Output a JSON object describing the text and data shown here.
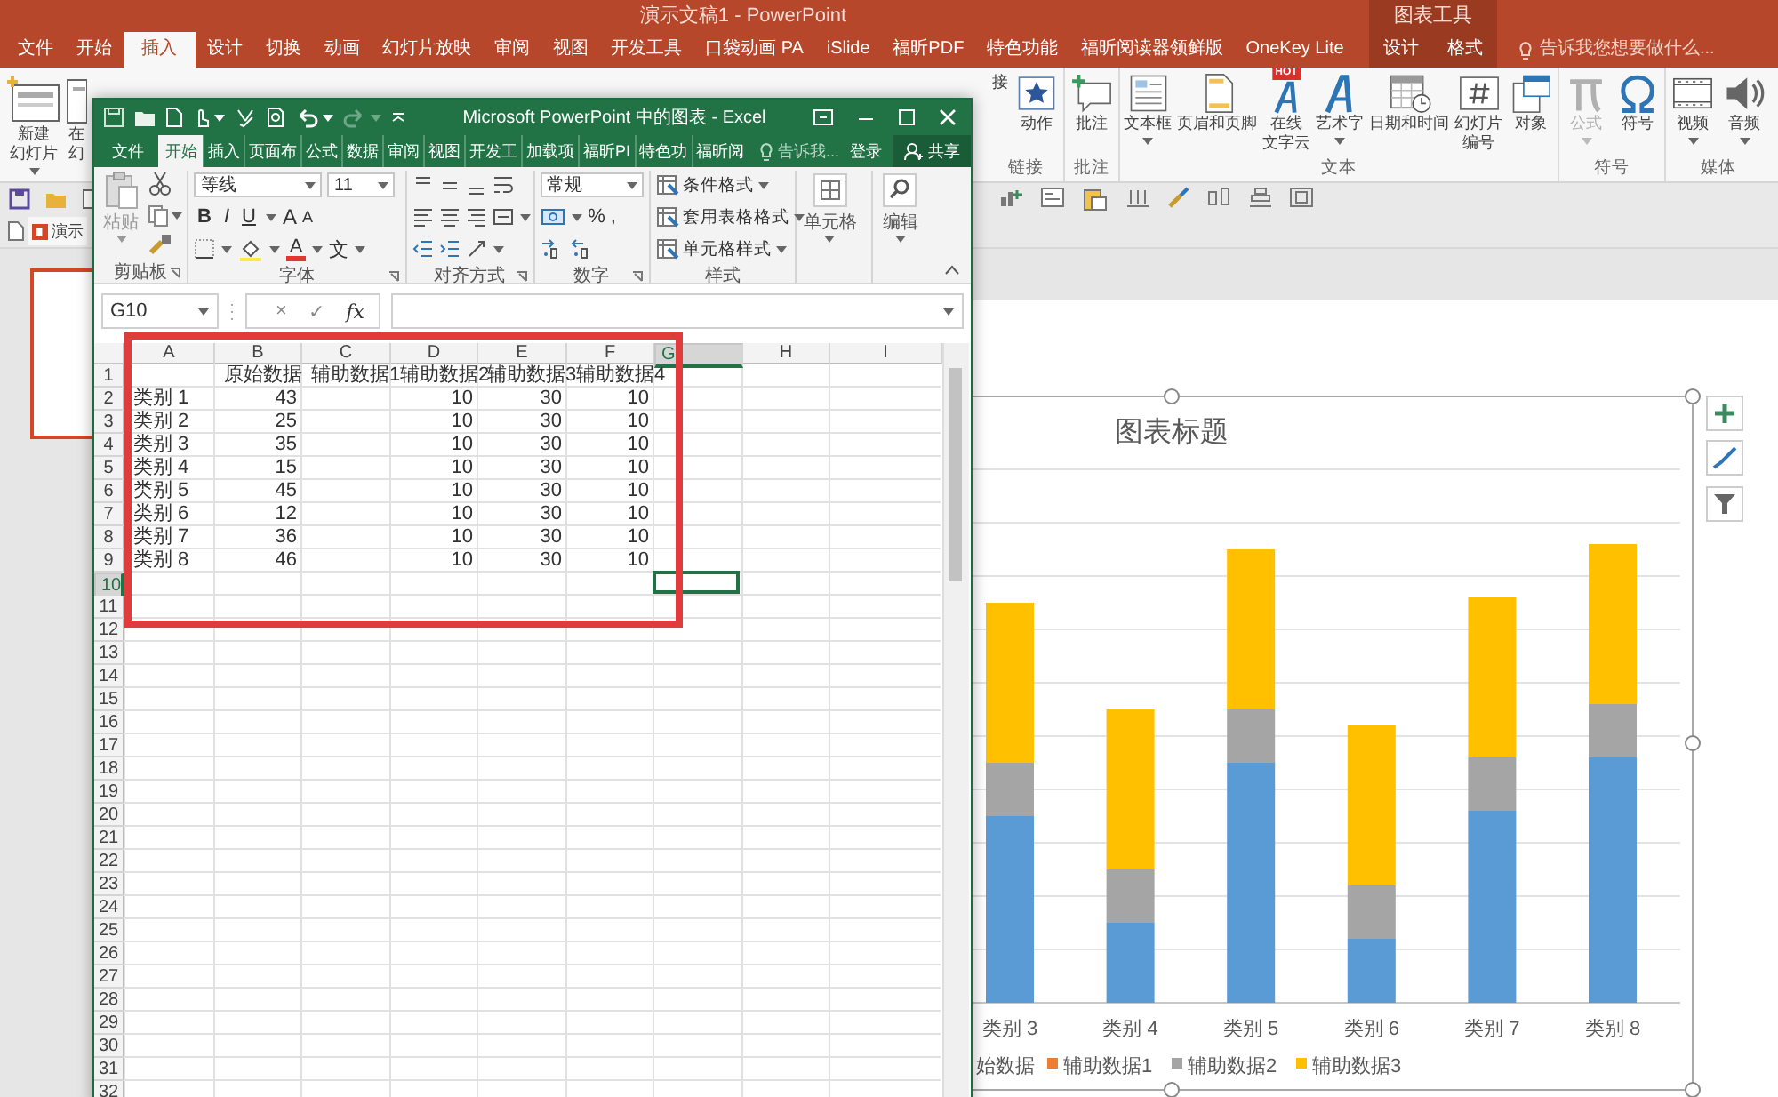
{
  "powerpoint": {
    "title": "演示文稿1 - PowerPoint",
    "context_label": "图表工具",
    "tabs": [
      {
        "label": "文件",
        "selected": false,
        "contextual": false
      },
      {
        "label": "开始",
        "selected": false,
        "contextual": false
      },
      {
        "label": "插入",
        "selected": true,
        "contextual": false
      },
      {
        "label": "设计",
        "selected": false,
        "contextual": false
      },
      {
        "label": "切换",
        "selected": false,
        "contextual": false
      },
      {
        "label": "动画",
        "selected": false,
        "contextual": false
      },
      {
        "label": "幻灯片放映",
        "selected": false,
        "contextual": false
      },
      {
        "label": "审阅",
        "selected": false,
        "contextual": false
      },
      {
        "label": "视图",
        "selected": false,
        "contextual": false
      },
      {
        "label": "开发工具",
        "selected": false,
        "contextual": false
      },
      {
        "label": "口袋动画 PA",
        "selected": false,
        "contextual": false
      },
      {
        "label": "iSlide",
        "selected": false,
        "contextual": false
      },
      {
        "label": "福昕PDF",
        "selected": false,
        "contextual": false
      },
      {
        "label": "特色功能",
        "selected": false,
        "contextual": false
      },
      {
        "label": "福昕阅读器领鲜版",
        "selected": false,
        "contextual": false
      },
      {
        "label": "OneKey Lite",
        "selected": false,
        "contextual": false
      },
      {
        "label": "设计",
        "selected": false,
        "contextual": true
      },
      {
        "label": "格式",
        "selected": false,
        "contextual": true
      }
    ],
    "tell_me": "告诉我您想要做什么...",
    "ribbon_left": [
      {
        "lines": [
          "新建",
          "幻灯片"
        ],
        "dropdown": true,
        "disabled": false
      },
      {
        "lines": [
          "在",
          "幻"
        ],
        "dropdown": false,
        "disabled": false
      }
    ],
    "ribbon_groups": [
      {
        "label": "链接",
        "buttons": [
          {
            "lines": [
              "接"
            ],
            "dropdown": false,
            "disabled": false
          },
          {
            "lines": [
              "动作"
            ],
            "dropdown": false,
            "disabled": false
          }
        ]
      },
      {
        "label": "批注",
        "buttons": [
          {
            "lines": [
              "批注"
            ],
            "dropdown": false,
            "disabled": false
          }
        ]
      },
      {
        "label": "文本",
        "buttons": [
          {
            "lines": [
              "文本框"
            ],
            "dropdown": true,
            "disabled": false
          },
          {
            "lines": [
              "页眉和页脚"
            ],
            "dropdown": false,
            "disabled": false
          },
          {
            "lines": [
              "在线",
              "文字云"
            ],
            "badge": "HOT",
            "dropdown": false,
            "disabled": false
          },
          {
            "lines": [
              "艺术字"
            ],
            "dropdown": true,
            "disabled": false
          },
          {
            "lines": [
              "日期和时间"
            ],
            "dropdown": false,
            "disabled": false
          },
          {
            "lines": [
              "幻灯片",
              "编号"
            ],
            "dropdown": false,
            "disabled": false
          },
          {
            "lines": [
              "对象"
            ],
            "dropdown": false,
            "disabled": false
          }
        ]
      },
      {
        "label": "符号",
        "buttons": [
          {
            "lines": [
              "公式"
            ],
            "dropdown": true,
            "disabled": true
          },
          {
            "lines": [
              "符号"
            ],
            "dropdown": false,
            "disabled": false
          }
        ]
      },
      {
        "label": "媒体",
        "buttons": [
          {
            "lines": [
              "视频"
            ],
            "dropdown": true,
            "disabled": false
          },
          {
            "lines": [
              "音频"
            ],
            "dropdown": true,
            "disabled": false
          }
        ]
      }
    ],
    "document_tab": "演示"
  },
  "excel": {
    "title": "Microsoft PowerPoint 中的图表 - Excel",
    "tabs": [
      {
        "label": "文件",
        "selected": false
      },
      {
        "label": "开始",
        "selected": true
      },
      {
        "label": "插入",
        "selected": false
      },
      {
        "label": "页面布",
        "selected": false
      },
      {
        "label": "公式",
        "selected": false
      },
      {
        "label": "数据",
        "selected": false
      },
      {
        "label": "审阅",
        "selected": false
      },
      {
        "label": "视图",
        "selected": false
      },
      {
        "label": "开发工",
        "selected": false
      },
      {
        "label": "加载项",
        "selected": false
      },
      {
        "label": "福昕PI",
        "selected": false
      },
      {
        "label": "特色功",
        "selected": false
      },
      {
        "label": "福昕阅",
        "selected": false
      }
    ],
    "tell_me": "告诉我...",
    "sign_in": "登录",
    "share": "共享",
    "paste": "粘贴",
    "font": {
      "name": "等线",
      "size": "11",
      "format_buttons": [
        "B",
        "I",
        "U"
      ],
      "grow": "A",
      "shrink": "A",
      "color_button": "A",
      "phonetic": "文"
    },
    "number": {
      "format": "常规",
      "percent": "%",
      "comma": ","
    },
    "styles": [
      "条件格式",
      "套用表格格式",
      "单元格样式"
    ],
    "cells": "单元格",
    "editing": "编辑",
    "group_labels": [
      "剪贴板",
      "字体",
      "对齐方式",
      "数字",
      "样式"
    ],
    "name_box": "G10",
    "formula_buttons": [
      "×",
      "✓",
      "fx"
    ],
    "columns": [
      {
        "label": "A",
        "selected": false
      },
      {
        "label": "B",
        "selected": false
      },
      {
        "label": "C",
        "selected": false
      },
      {
        "label": "D",
        "selected": false
      },
      {
        "label": "E",
        "selected": false
      },
      {
        "label": "F",
        "selected": false
      },
      {
        "label": "G",
        "selected": true
      },
      {
        "label": "H",
        "selected": false
      },
      {
        "label": "I",
        "selected": false
      }
    ],
    "row_numbers": [
      {
        "label": "1",
        "selected": false
      },
      {
        "label": "2",
        "selected": false
      },
      {
        "label": "3",
        "selected": false
      },
      {
        "label": "4",
        "selected": false
      },
      {
        "label": "5",
        "selected": false
      },
      {
        "label": "6",
        "selected": false
      },
      {
        "label": "7",
        "selected": false
      },
      {
        "label": "8",
        "selected": false
      },
      {
        "label": "9",
        "selected": false
      },
      {
        "label": "10",
        "selected": true
      },
      {
        "label": "11",
        "selected": false
      },
      {
        "label": "12",
        "selected": false
      },
      {
        "label": "13",
        "selected": false
      },
      {
        "label": "14",
        "selected": false
      },
      {
        "label": "15",
        "selected": false
      },
      {
        "label": "16",
        "selected": false
      },
      {
        "label": "17",
        "selected": false
      },
      {
        "label": "18",
        "selected": false
      },
      {
        "label": "19",
        "selected": false
      },
      {
        "label": "20",
        "selected": false
      },
      {
        "label": "21",
        "selected": false
      },
      {
        "label": "22",
        "selected": false
      },
      {
        "label": "23",
        "selected": false
      },
      {
        "label": "24",
        "selected": false
      },
      {
        "label": "25",
        "selected": false
      },
      {
        "label": "26",
        "selected": false
      },
      {
        "label": "27",
        "selected": false
      },
      {
        "label": "28",
        "selected": false
      },
      {
        "label": "29",
        "selected": false
      },
      {
        "label": "30",
        "selected": false
      },
      {
        "label": "31",
        "selected": false
      },
      {
        "label": "32",
        "selected": false
      }
    ],
    "header_row": [
      "原始数据",
      "辅助数据1",
      "辅助数据2",
      "辅助数据3",
      "辅助数据4"
    ],
    "rows": [
      [
        "类别 1",
        "43",
        "",
        "10",
        "30",
        "10"
      ],
      [
        "类别 2",
        "25",
        "",
        "10",
        "30",
        "10"
      ],
      [
        "类别 3",
        "35",
        "",
        "10",
        "30",
        "10"
      ],
      [
        "类别 4",
        "15",
        "",
        "10",
        "30",
        "10"
      ],
      [
        "类别 5",
        "45",
        "",
        "10",
        "30",
        "10"
      ],
      [
        "类别 6",
        "12",
        "",
        "10",
        "30",
        "10"
      ],
      [
        "类别 7",
        "36",
        "",
        "10",
        "30",
        "10"
      ],
      [
        "类别 8",
        "46",
        "",
        "10",
        "30",
        "10"
      ]
    ]
  },
  "chart": {
    "title": "图表标题",
    "categories": [
      "类别 3",
      "类别 4",
      "类别 5",
      "类别 6",
      "类别 7",
      "类别 8"
    ],
    "legend": [
      {
        "label": "始数据",
        "color": "#5b9bd5"
      },
      {
        "label": "辅助数据1",
        "color": "#ed7d31"
      },
      {
        "label": "辅助数据2",
        "color": "#a5a5a5"
      },
      {
        "label": "辅助数据3",
        "color": "#ffc000"
      }
    ]
  }
}
